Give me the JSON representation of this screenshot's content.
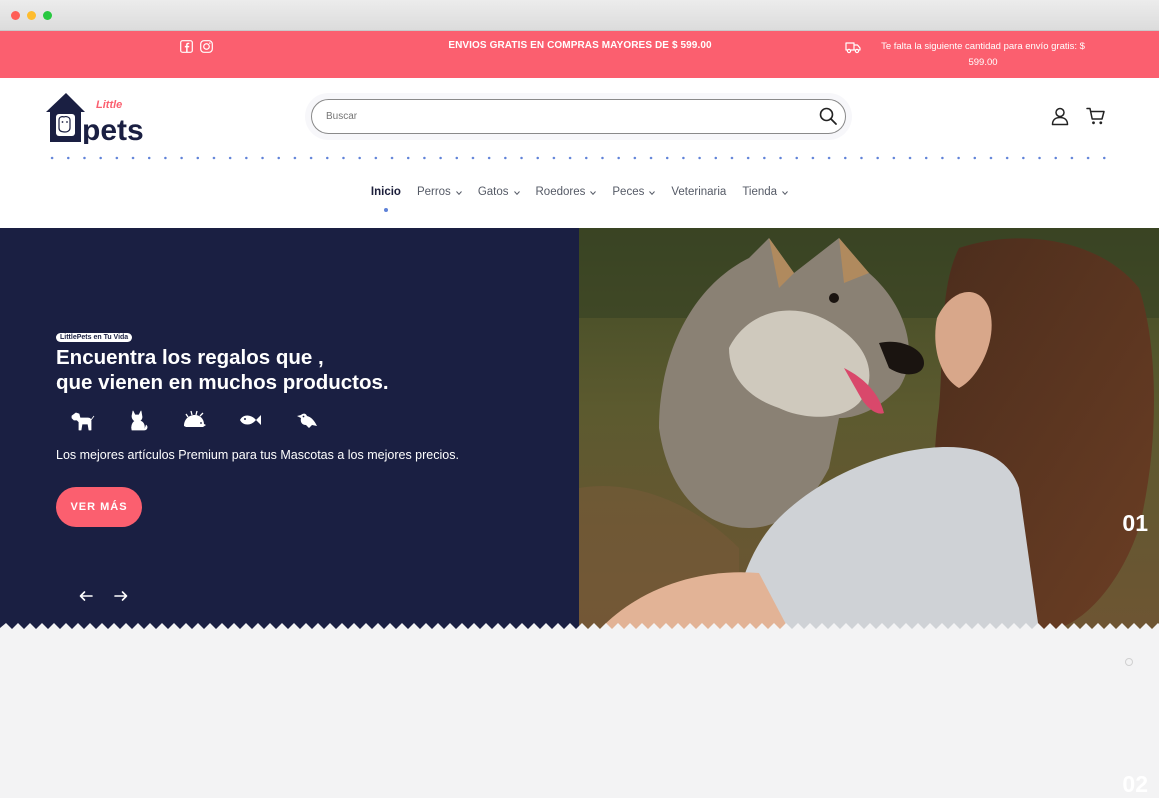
{
  "colors": {
    "brand_coral": "#fb5f6f",
    "brand_navy": "#1a1f42",
    "accent_blue": "#5f82d8"
  },
  "announcement": {
    "social_icons": [
      "facebook-icon",
      "instagram-icon"
    ],
    "promo": "ENVIOS GRATIS EN COMPRAS MAYORES DE $ 599.00",
    "shipping_icon": "truck-icon",
    "shipping_text": "Te falta la siguiente cantidad para envío gratis: $ 599.00"
  },
  "header": {
    "logo_small": "Little",
    "logo_big": "pets",
    "search_placeholder": "Buscar",
    "icons": [
      "search-icon",
      "user-icon",
      "cart-icon"
    ]
  },
  "nav": {
    "items": [
      {
        "label": "Inicio",
        "active": true,
        "dropdown": false
      },
      {
        "label": "Perros",
        "active": false,
        "dropdown": true
      },
      {
        "label": "Gatos",
        "active": false,
        "dropdown": true
      },
      {
        "label": "Roedores",
        "active": false,
        "dropdown": true
      },
      {
        "label": "Peces",
        "active": false,
        "dropdown": true
      },
      {
        "label": "Veterinaria",
        "active": false,
        "dropdown": false
      },
      {
        "label": "Tienda",
        "active": false,
        "dropdown": true
      }
    ]
  },
  "hero": {
    "badge": "LittlePets en Tu Vida",
    "headline_line1": "Encuentra los regalos que ,",
    "headline_line2": "que vienen en muchos productos.",
    "animal_icons": [
      "dog-icon",
      "cat-icon",
      "hedgehog-icon",
      "fish-icon",
      "bird-icon"
    ],
    "subtitle": "Los mejores artículos Premium para tus Mascotas a los mejores precios.",
    "cta_label": "VER MÁS",
    "slide_current": "01",
    "slide_next": "02",
    "active_slide_index": 0
  }
}
